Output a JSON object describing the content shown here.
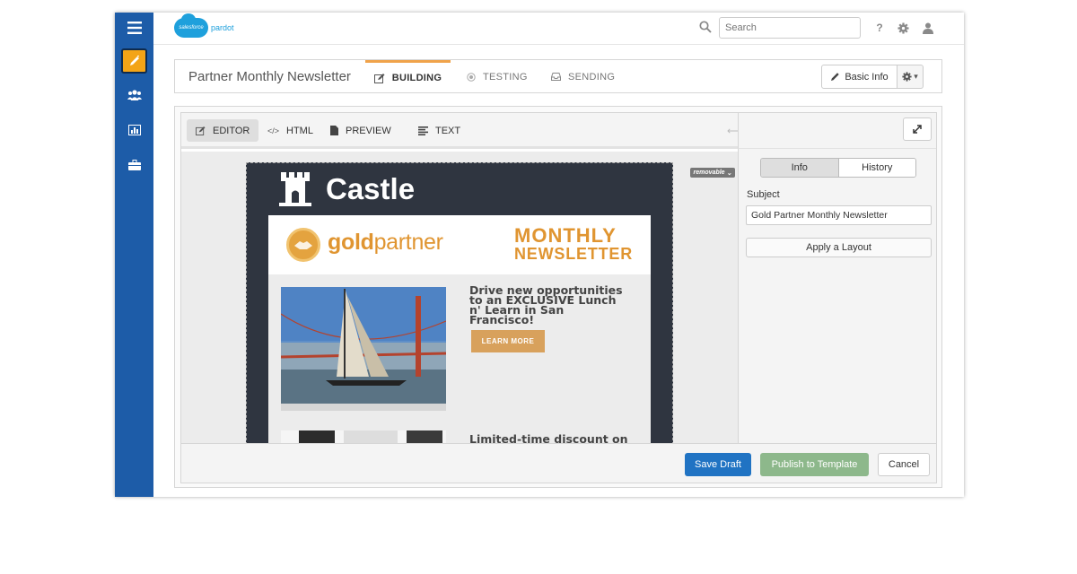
{
  "header": {
    "logo_badge": "salesforce",
    "logo_text": "pardot",
    "search_placeholder": "Search",
    "help_glyph": "?"
  },
  "rail": {
    "items": [
      {
        "icon": "menu-icon"
      },
      {
        "icon": "edit-icon",
        "active": true
      },
      {
        "icon": "users-icon"
      },
      {
        "icon": "chart-icon"
      },
      {
        "icon": "briefcase-icon"
      }
    ]
  },
  "titlebar": {
    "title": "Partner Monthly Newsletter",
    "steps": [
      {
        "label": "BUILDING",
        "active": true
      },
      {
        "label": "TESTING",
        "active": false
      },
      {
        "label": "SENDING",
        "active": false
      }
    ],
    "basic_info_label": "Basic Info"
  },
  "editor": {
    "tabs": [
      {
        "label": "EDITOR",
        "active": true
      },
      {
        "label": "HTML",
        "active": false
      },
      {
        "label": "PREVIEW",
        "active": false
      },
      {
        "label": "TEXT",
        "active": false
      }
    ]
  },
  "email": {
    "removable_badge": "removable",
    "brand_name": "Castle",
    "partner_logo_bold": "gold",
    "partner_logo_light": "partner",
    "title_line1": "MONTHLY",
    "title_line2": "NEWSLETTER",
    "article1_headline": "Drive new opportunities to an EXCLUSIVE Lunch n' Learn in San Francisco!",
    "article1_button": "LEARN MORE",
    "article2_headline": "Limited-time discount on"
  },
  "panel": {
    "tabs": [
      {
        "label": "Info",
        "active": true
      },
      {
        "label": "History",
        "active": false
      }
    ],
    "subject_label": "Subject",
    "subject_value": "Gold Partner Monthly Newsletter",
    "apply_layout_label": "Apply a Layout"
  },
  "footer": {
    "save_draft": "Save Draft",
    "publish": "Publish to Template",
    "cancel": "Cancel"
  },
  "colors": {
    "rail": "#1d5ca8",
    "accent_orange": "#f0a34a",
    "primary_blue": "#2073c3",
    "publish_green": "#8db88b",
    "gold": "#e09531"
  }
}
